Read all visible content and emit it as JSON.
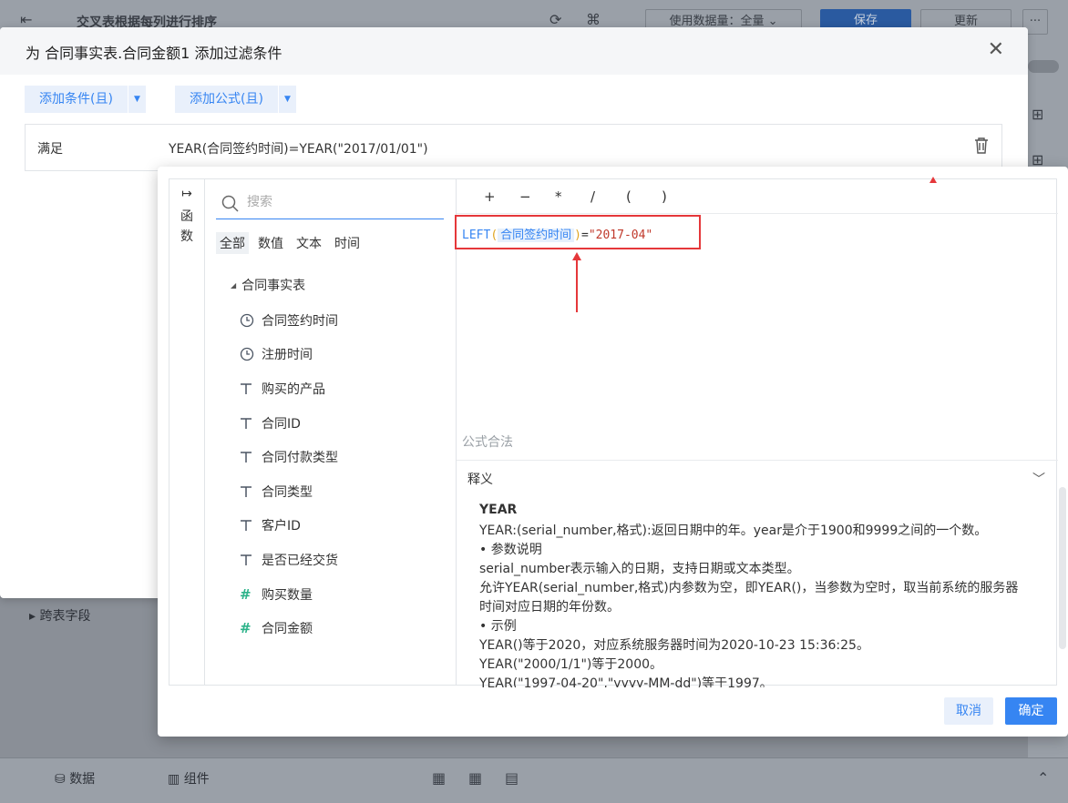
{
  "app": {
    "report_title": "交叉表根据每列进行排序",
    "data_usage": "使用数据量：全量",
    "save_label": "保存",
    "update_label": "更新",
    "more_label": "···",
    "cross_table_fields": "跨表字段",
    "bottom_tab_data": "数据",
    "bottom_tab_component": "组件"
  },
  "filter_dialog": {
    "title": "为 合同事实表.合同金额1 添加过滤条件",
    "add_condition": "添加条件(且)",
    "add_formula": "添加公式(且)",
    "condition_key": "满足",
    "condition_value": "YEAR(合同签约时间)=YEAR(\"2017/01/01\")"
  },
  "formula_editor": {
    "rail_label_1": "函",
    "rail_label_2": "数",
    "search_placeholder": "搜索",
    "tabs": [
      "全部",
      "数值",
      "文本",
      "时间"
    ],
    "active_tab": "全部",
    "table_name": "合同事实表",
    "fields": [
      {
        "name": "合同签约时间",
        "icon": "clock-icon"
      },
      {
        "name": "注册时间",
        "icon": "clock-icon"
      },
      {
        "name": "购买的产品",
        "icon": "text-type-icon"
      },
      {
        "name": "合同ID",
        "icon": "text-type-icon"
      },
      {
        "name": "合同付款类型",
        "icon": "text-type-icon"
      },
      {
        "name": "合同类型",
        "icon": "text-type-icon"
      },
      {
        "name": "客户ID",
        "icon": "text-type-icon"
      },
      {
        "name": "是否已经交货",
        "icon": "text-type-icon"
      },
      {
        "name": "购买数量",
        "icon": "number-type-icon"
      },
      {
        "name": "合同金额",
        "icon": "number-type-icon"
      }
    ],
    "operators": [
      "+",
      "−",
      "*",
      "/",
      "(",
      ")"
    ],
    "formula": {
      "fn": "LEFT",
      "open": "(",
      "field": "合同签约时间",
      "close": ")",
      "op": "=",
      "str": "\"2017-04\""
    },
    "validity": "公式合法",
    "explain_header": "释义",
    "explain_lines": [
      "YEAR",
      "YEAR:(serial_number,格式):返回日期中的年。year是介于1900和9999之间的一个数。",
      "•  参数说明",
      "serial_number表示输入的日期，支持日期或文本类型。",
      "允许YEAR(serial_number,格式)内参数为空，即YEAR()，当参数为空时，取当前系统的服务器时间对应日期的年份数。",
      "•  示例",
      "YEAR()等于2020，对应系统服务器时间为2020-10-23 15:36:25。",
      "YEAR(\"2000/1/1\")等于2000。",
      "YEAR(\"1997-04-20\",\"yyyy-MM-dd\")等于1997。"
    ],
    "cancel_label": "取消",
    "ok_label": "确定"
  },
  "colors": {
    "primary": "#3685f2",
    "highlight_red": "#e5373a",
    "number_icon": "#2db38a"
  }
}
